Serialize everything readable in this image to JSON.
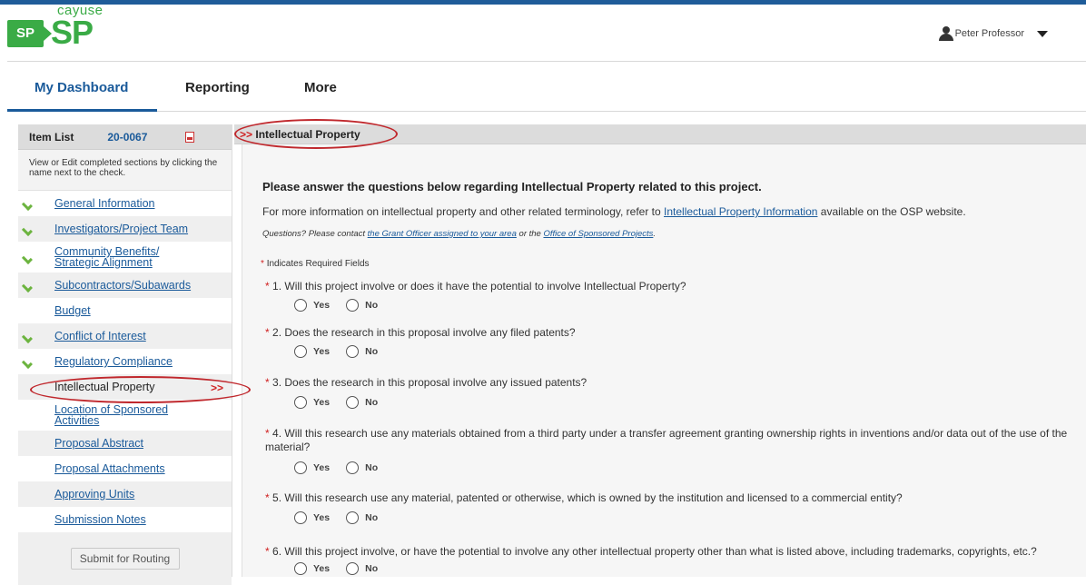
{
  "header": {
    "logo_top": "cayuse",
    "logo_badge": "SP",
    "logo_brand": "SP",
    "user_name": "Peter Professor"
  },
  "nav": {
    "tabs": [
      "My Dashboard",
      "Reporting",
      "More"
    ]
  },
  "sidebar": {
    "title": "Item List",
    "code": "20-0067",
    "help": "View or Edit completed sections by clicking the name next to the check.",
    "items": [
      {
        "label": "General Information",
        "checked": true
      },
      {
        "label": "Investigators/Project Team",
        "checked": true
      },
      {
        "label": "Community Benefits/ Strategic Alignment",
        "checked": true
      },
      {
        "label": "Subcontractors/Subawards",
        "checked": true
      },
      {
        "label": "Budget",
        "checked": false
      },
      {
        "label": "Conflict of Interest",
        "checked": true
      },
      {
        "label": "Regulatory Compliance",
        "checked": true
      },
      {
        "label": "Intellectual Property",
        "checked": false,
        "current": true,
        "marker": ">>"
      },
      {
        "label": "Location of Sponsored Activities",
        "checked": false
      },
      {
        "label": "Proposal Abstract",
        "checked": false
      },
      {
        "label": "Proposal Attachments",
        "checked": false
      },
      {
        "label": "Approving Units",
        "checked": false
      },
      {
        "label": "Submission Notes",
        "checked": false
      }
    ],
    "submit_label": "Submit for Routing"
  },
  "main": {
    "heading_marker": ">>",
    "heading": "Intellectual Property",
    "intro_title": "Please answer the questions below regarding Intellectual Property related to this project.",
    "intro_before": "For more information on intellectual property and other related terminology, refer to",
    "intro_link": "Intellectual Property Information",
    "intro_after": "available on the OSP website.",
    "contact_before": "Questions? Please contact",
    "contact_link1": "the Grant Officer assigned to your area",
    "contact_mid": "or the",
    "contact_link2": "Office of Sponsored Projects",
    "contact_end": ".",
    "required_star": "*",
    "required_note": "Indicates Required Fields",
    "option_yes": "Yes",
    "option_no": "No",
    "questions": [
      {
        "number": "1.",
        "text": "Will this project involve or does it have the potential to involve Intellectual Property?"
      },
      {
        "number": "2.",
        "text": "Does the research in this proposal involve any filed patents?"
      },
      {
        "number": "3.",
        "text": "Does the research in this proposal involve any issued patents?"
      },
      {
        "number": "4.",
        "text": "Will this research use any materials obtained from a third party under a transfer agreement granting ownership rights in inventions and/or data out of the use of the material?"
      },
      {
        "number": "5.",
        "text": "Will this research use any material, patented or otherwise, which is owned by the institution and licensed to a commercial entity?"
      },
      {
        "number": "6.",
        "text": "Will this project involve, or have the potential to involve any other intellectual property other than what is listed above, including trademarks, copyrights, etc.?"
      }
    ]
  },
  "colors": {
    "brand_green": "#3aab46",
    "link_blue": "#1a5a9a",
    "annotation_red": "#c0282d"
  }
}
